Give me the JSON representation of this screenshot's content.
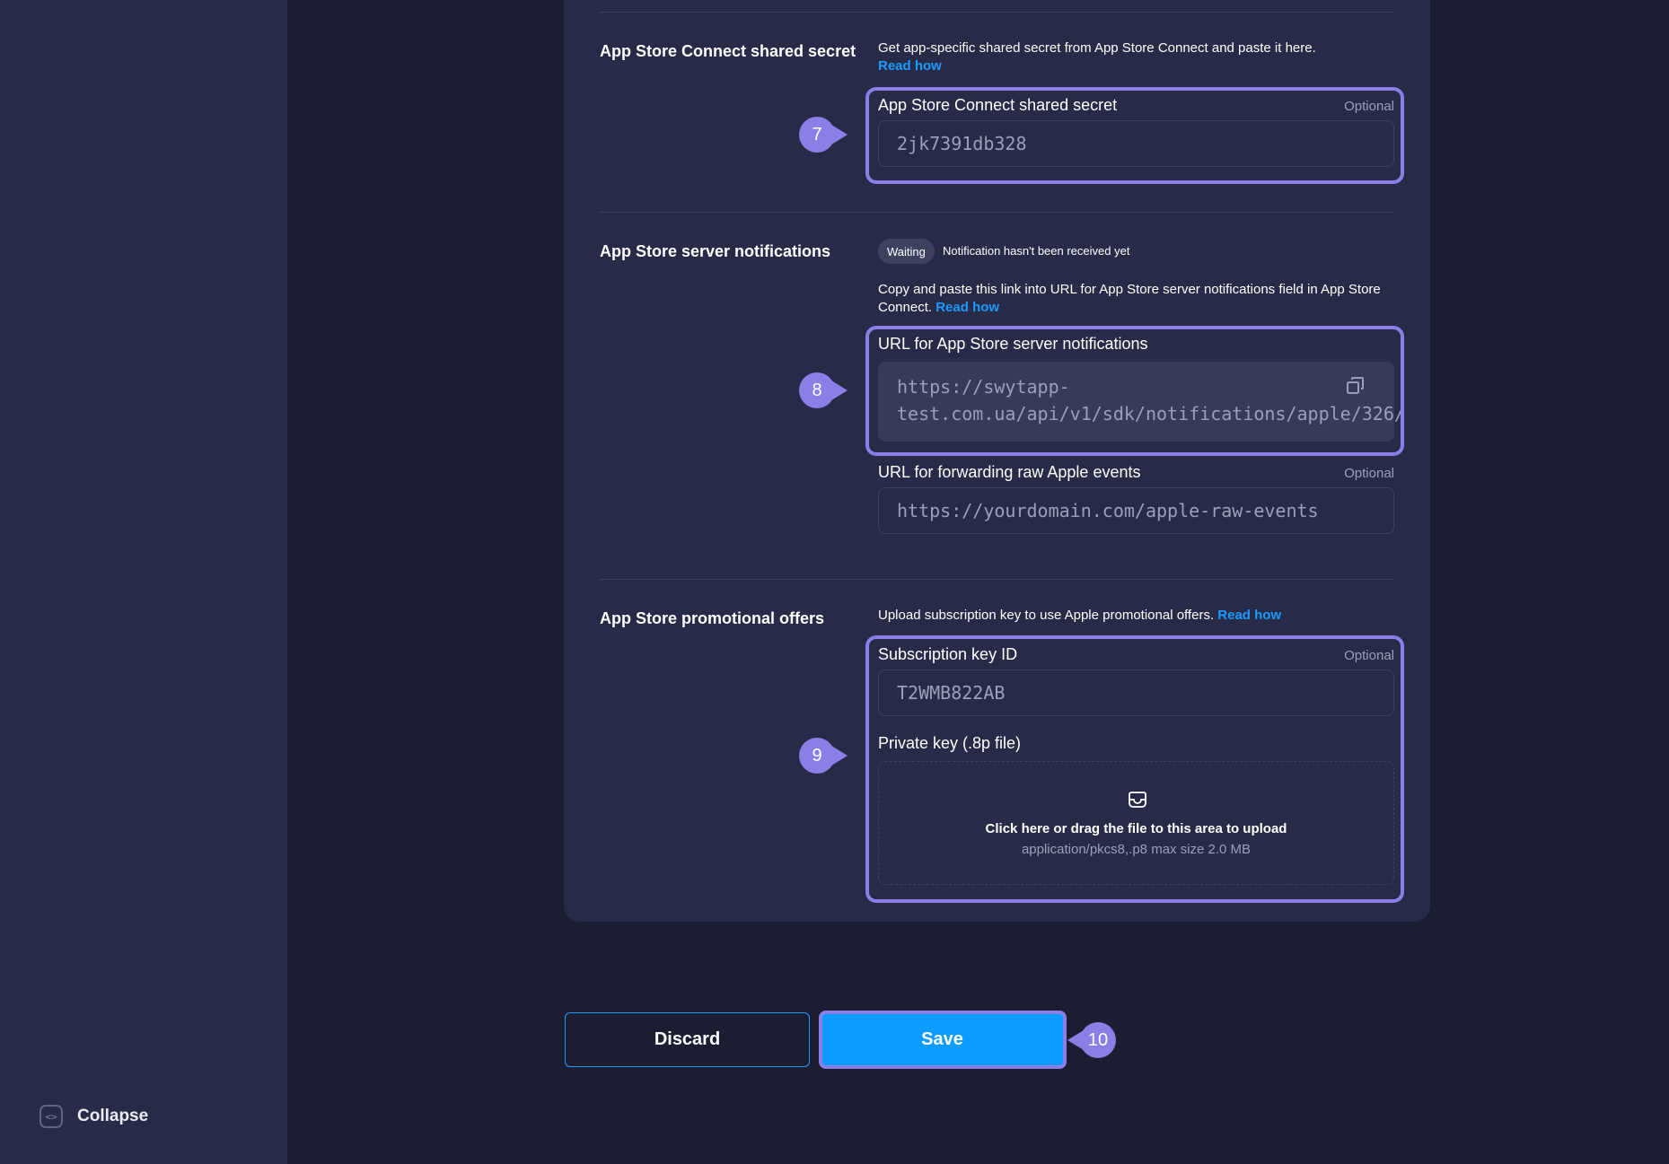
{
  "sidebar": {
    "collapse_label": "Collapse"
  },
  "shared_secret": {
    "title": "App Store Connect shared secret",
    "description": "Get app-specific shared secret from App Store Connect and paste it here.",
    "read_how": "Read how",
    "field_label": "App Store Connect shared secret",
    "optional": "Optional",
    "value": "2jk7391db328",
    "badge": "7"
  },
  "server_notifications": {
    "title": "App Store server notifications",
    "status_badge": "Waiting",
    "status_text": "Notification hasn't been received yet",
    "description": "Copy and paste this link into URL for App Store server notifications field in App Store Connect.",
    "read_how": "Read how",
    "url_label": "URL for App Store server notifications",
    "url_line1": "https://swytapp-",
    "url_line2": "test.com.ua/api/v1/sdk/notifications/apple/326/",
    "badge": "8",
    "forward_label": "URL for forwarding raw Apple events",
    "forward_optional": "Optional",
    "forward_placeholder": "https://yourdomain.com/apple-raw-events"
  },
  "promo_offers": {
    "title": "App Store promotional offers",
    "description": "Upload subscription key to use Apple promotional offers.",
    "read_how": "Read how",
    "key_id_label": "Subscription key ID",
    "key_id_optional": "Optional",
    "key_id_value": "T2WMB822AB",
    "private_key_label": "Private key (.8p file)",
    "upload_main": "Click here or drag the file to this area to upload",
    "upload_sub": "application/pkcs8,.p8 max size 2.0 MB",
    "badge": "9"
  },
  "actions": {
    "discard": "Discard",
    "save": "Save",
    "save_badge": "10"
  },
  "colors": {
    "accent": "#0d9bff",
    "highlight": "#8b7ee6",
    "link": "#1a9bff"
  }
}
